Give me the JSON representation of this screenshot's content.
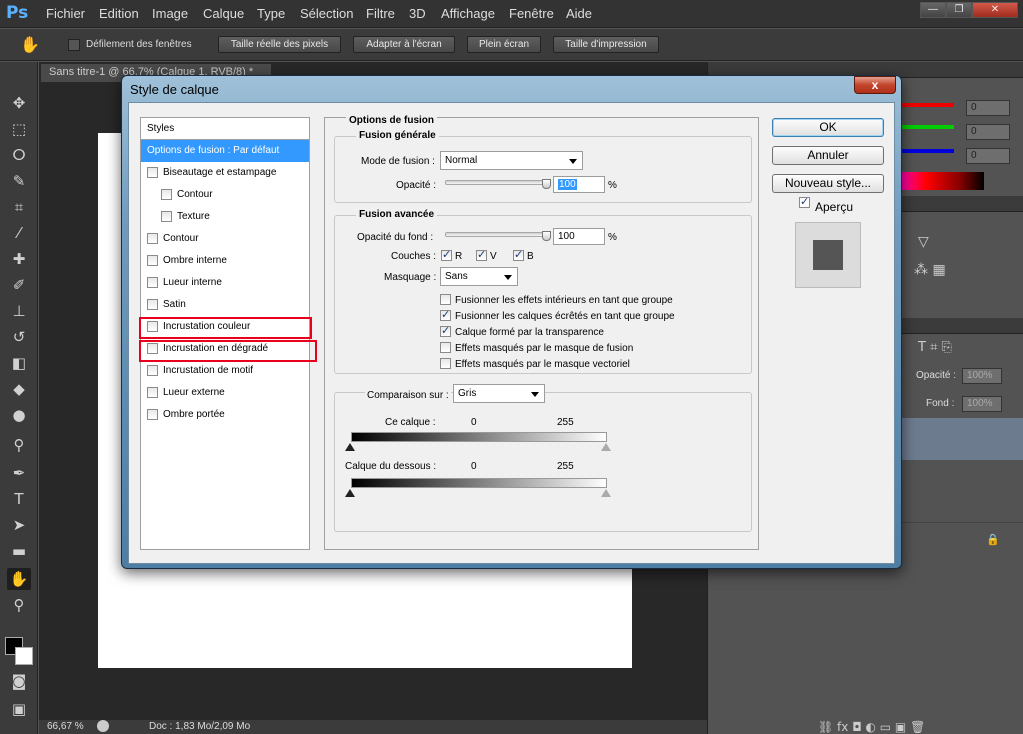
{
  "app": {
    "logo": "Ps"
  },
  "menu": [
    "Fichier",
    "Edition",
    "Image",
    "Calque",
    "Type",
    "Sélection",
    "Filtre",
    "3D",
    "Affichage",
    "Fenêtre",
    "Aide"
  ],
  "options_bar": {
    "scroll_all_label": "Défilement des fenêtres",
    "buttons": [
      "Taille réelle des pixels",
      "Adapter à l'écran",
      "Plein écran",
      "Taille d'impression"
    ]
  },
  "document": {
    "tab": "Sans titre-1 @ 66,7% (Calque 1, RVB/8) *",
    "zoom": "66,67 %",
    "doc_info": "Doc : 1,83 Mo/2,09 Mo"
  },
  "right_panel": {
    "color_values": [
      "0",
      "0",
      "0"
    ],
    "opacity_label": "Opacité :",
    "opacity_value": "100%",
    "fill_label": "Fond :",
    "fill_value": "100%"
  },
  "dialog": {
    "title": "Style de calque",
    "close": "x",
    "styles_header": "Styles",
    "style_items": [
      {
        "label": "Options de fusion : Par défaut",
        "checkbox": false,
        "selected": true,
        "indent": false
      },
      {
        "label": "Biseautage et estampage",
        "checkbox": true,
        "checked": false,
        "indent": false
      },
      {
        "label": "Contour",
        "checkbox": true,
        "checked": false,
        "indent": true
      },
      {
        "label": "Texture",
        "checkbox": true,
        "checked": false,
        "indent": true
      },
      {
        "label": "Contour",
        "checkbox": true,
        "checked": false,
        "indent": false
      },
      {
        "label": "Ombre interne",
        "checkbox": true,
        "checked": false,
        "indent": false
      },
      {
        "label": "Lueur interne",
        "checkbox": true,
        "checked": false,
        "indent": false
      },
      {
        "label": "Satin",
        "checkbox": true,
        "checked": false,
        "indent": false
      },
      {
        "label": "Incrustation couleur",
        "checkbox": true,
        "checked": false,
        "indent": false
      },
      {
        "label": "Incrustation en dégradé",
        "checkbox": true,
        "checked": false,
        "indent": false
      },
      {
        "label": "Incrustation de motif",
        "checkbox": true,
        "checked": false,
        "indent": false
      },
      {
        "label": "Lueur externe",
        "checkbox": true,
        "checked": false,
        "indent": false
      },
      {
        "label": "Ombre portée",
        "checkbox": true,
        "checked": false,
        "indent": false
      }
    ],
    "options_title": "Options de fusion",
    "general": {
      "title": "Fusion générale",
      "mode_label": "Mode de fusion :",
      "mode_value": "Normal",
      "opacity_label": "Opacité :",
      "opacity_value": "100",
      "opacity_unit": "%",
      "opacity_level": 1.0
    },
    "advanced": {
      "title": "Fusion avancée",
      "fill_label": "Opacité du fond :",
      "fill_value": "100",
      "fill_unit": "%",
      "fill_level": 1.0,
      "channels_label": "Couches :",
      "channels": [
        {
          "label": "R",
          "checked": true
        },
        {
          "label": "V",
          "checked": true
        },
        {
          "label": "B",
          "checked": true
        }
      ],
      "knockout_label": "Masquage :",
      "knockout_value": "Sans",
      "checkboxes": [
        {
          "label": "Fusionner les effets intérieurs en tant que groupe",
          "checked": false
        },
        {
          "label": "Fusionner les calques écrêtés en tant que groupe",
          "checked": true
        },
        {
          "label": "Calque formé par la transparence",
          "checked": true
        },
        {
          "label": "Effets masqués par le masque de fusion",
          "checked": false
        },
        {
          "label": "Effets masqués par le masque vectoriel",
          "checked": false
        }
      ]
    },
    "blend_if": {
      "label": "Comparaison sur :",
      "value": "Gris",
      "this_layer_label": "Ce calque :",
      "this_layer_min": "0",
      "this_layer_max": "255",
      "underlying_label": "Calque du dessous :",
      "underlying_min": "0",
      "underlying_max": "255"
    },
    "buttons": {
      "ok": "OK",
      "cancel": "Annuler",
      "new_style": "Nouveau style...",
      "preview_label": "Aperçu",
      "preview_checked": true
    }
  }
}
